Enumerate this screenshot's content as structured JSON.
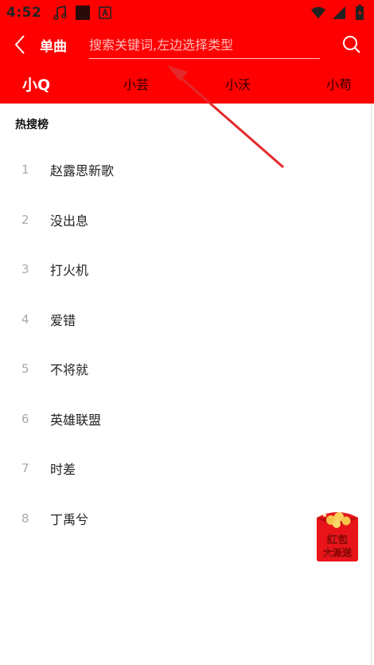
{
  "status_bar": {
    "time": "4:52",
    "icons_left": [
      "music-note-icon",
      "app-square-icon",
      "a-badge-icon"
    ],
    "icons_right": [
      "wifi-icon",
      "signal-icon",
      "battery-icon"
    ]
  },
  "header": {
    "search_type_label": "单曲",
    "search_placeholder": "搜索关键词,左边选择类型"
  },
  "tabs": [
    {
      "label": "小Q",
      "active": true
    },
    {
      "label": "小芸",
      "active": false
    },
    {
      "label": "小沃",
      "active": false
    },
    {
      "label": "小苟",
      "active": false
    }
  ],
  "hot_search": {
    "title": "热搜榜",
    "items": [
      {
        "rank": "1",
        "text": "赵露思新歌"
      },
      {
        "rank": "2",
        "text": "没出息"
      },
      {
        "rank": "3",
        "text": "打火机"
      },
      {
        "rank": "4",
        "text": "爱错"
      },
      {
        "rank": "5",
        "text": "不将就"
      },
      {
        "rank": "6",
        "text": "英雄联盟"
      },
      {
        "rank": "7",
        "text": "时差"
      },
      {
        "rank": "8",
        "text": "丁禹兮"
      }
    ]
  },
  "red_packet": {
    "line1": "红包",
    "line2": "大派送"
  },
  "colors": {
    "primary_red": "#ff0000",
    "rank_gray": "#a9a9a9",
    "packet_gold": "#f7c24a"
  }
}
